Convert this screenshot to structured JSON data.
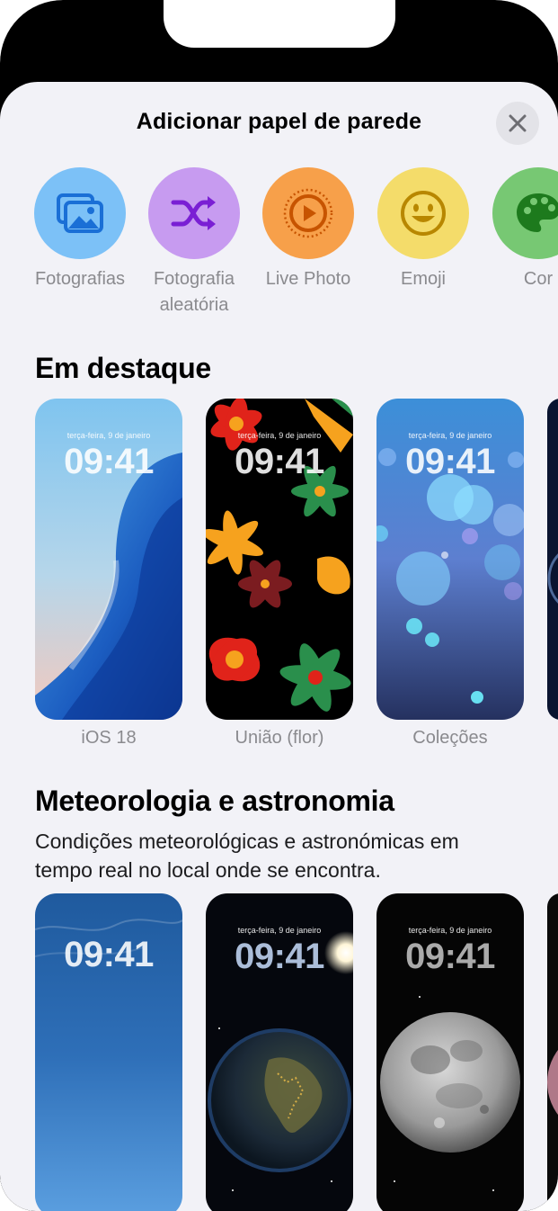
{
  "sheet": {
    "title": "Adicionar papel de parede",
    "close_icon": "close-icon"
  },
  "categories": [
    {
      "label": "Fotografias",
      "icon": "photos-icon",
      "color": "#7cc1f7"
    },
    {
      "label": "Fotografia aleatória",
      "icon": "shuffle-icon",
      "color": "#c79bf0"
    },
    {
      "label": "Live Photo",
      "icon": "live-photo-icon",
      "color": "#f7a04a"
    },
    {
      "label": "Emoji",
      "icon": "emoji-icon",
      "color": "#f4dc6a"
    },
    {
      "label": "Cor",
      "icon": "palette-icon",
      "color": "#77c873"
    }
  ],
  "featured": {
    "title": "Em destaque",
    "items": [
      {
        "label": "iOS 18",
        "date": "terça-feira, 9 de janeiro",
        "time": "09:41"
      },
      {
        "label": "União (flor)",
        "date": "terça-feira, 9 de janeiro",
        "time": "09:41"
      },
      {
        "label": "Coleções",
        "date": "terça-feira, 9 de janeiro",
        "time": "09:41"
      }
    ]
  },
  "weather": {
    "title": "Meteorologia e astronomia",
    "subtitle": "Condições meteorológicas e astronómicas em tempo real no local onde se encontra.",
    "items": [
      {
        "time": "09:41"
      },
      {
        "date": "terça-feira, 9 de janeiro",
        "time": "09:41"
      },
      {
        "date": "terça-feira, 9 de janeiro",
        "time": "09:41"
      }
    ]
  }
}
